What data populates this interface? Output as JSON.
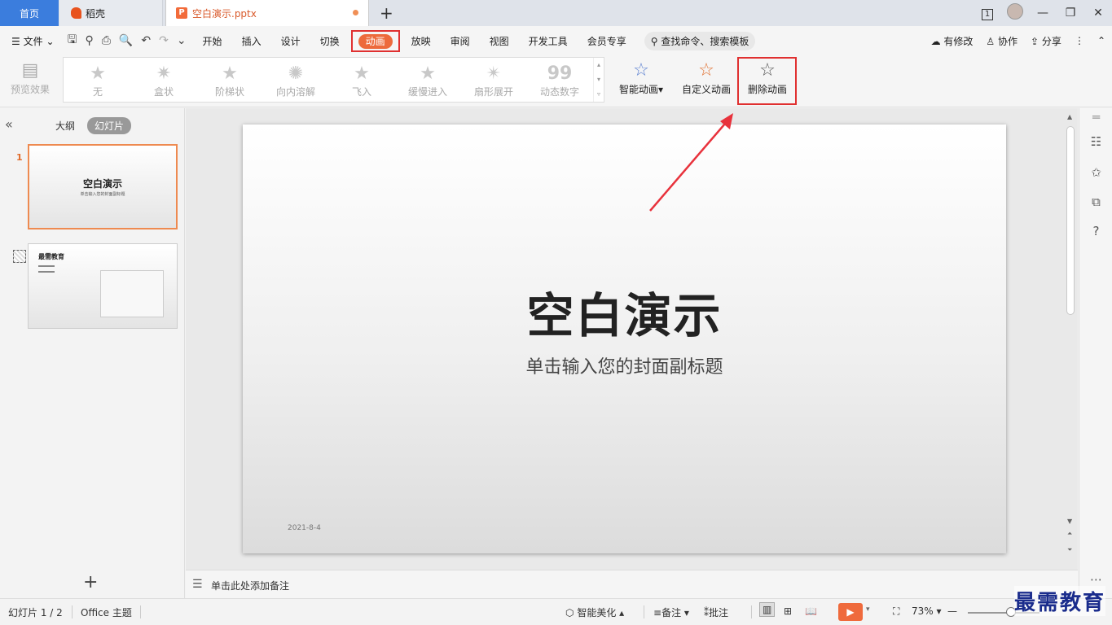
{
  "tabs": {
    "home": "首页",
    "daoke": "稻壳",
    "document": "空白演示.pptx",
    "document_badge": "P"
  },
  "window": {
    "badge": "1"
  },
  "menu": {
    "file": "文件",
    "items": [
      "开始",
      "插入",
      "设计",
      "切换",
      "动画",
      "放映",
      "审阅",
      "视图",
      "开发工具",
      "会员专享"
    ],
    "active": "动画",
    "search": "查找命令、搜索模板",
    "right": {
      "edit": "有修改",
      "collab": "协作",
      "share": "分享"
    }
  },
  "ribbon": {
    "preview": "预览效果",
    "gallery": [
      "无",
      "盒状",
      "阶梯状",
      "向内溶解",
      "飞入",
      "缓慢进入",
      "扇形展开",
      "动态数字"
    ],
    "smart_anim": "智能动画",
    "custom_anim": "自定义动画",
    "delete_anim": "删除动画"
  },
  "left_panel": {
    "tab_outline": "大纲",
    "tab_slides": "幻灯片",
    "slide1_num": "1",
    "slide1_title": "空白演示",
    "slide1_sub": "单击输入您的封面副标题",
    "slide2_title": "最需教育"
  },
  "slide": {
    "title": "空白演示",
    "subtitle": "单击输入您的封面副标题",
    "date": "2021-8-4"
  },
  "notes": {
    "placeholder": "单击此处添加备注"
  },
  "status": {
    "slide_count": "幻灯片 1 / 2",
    "theme": "Office 主题",
    "beautify": "智能美化",
    "notes": "备注",
    "comment": "批注",
    "zoom": "73%",
    "zoom_fraction": 0.73
  },
  "watermark": "最需教育",
  "colors": {
    "accent": "#ed6a3c",
    "highlight_box": "#e03030",
    "arrow": "#e8323c",
    "tab_blue": "#3b7ddd"
  }
}
